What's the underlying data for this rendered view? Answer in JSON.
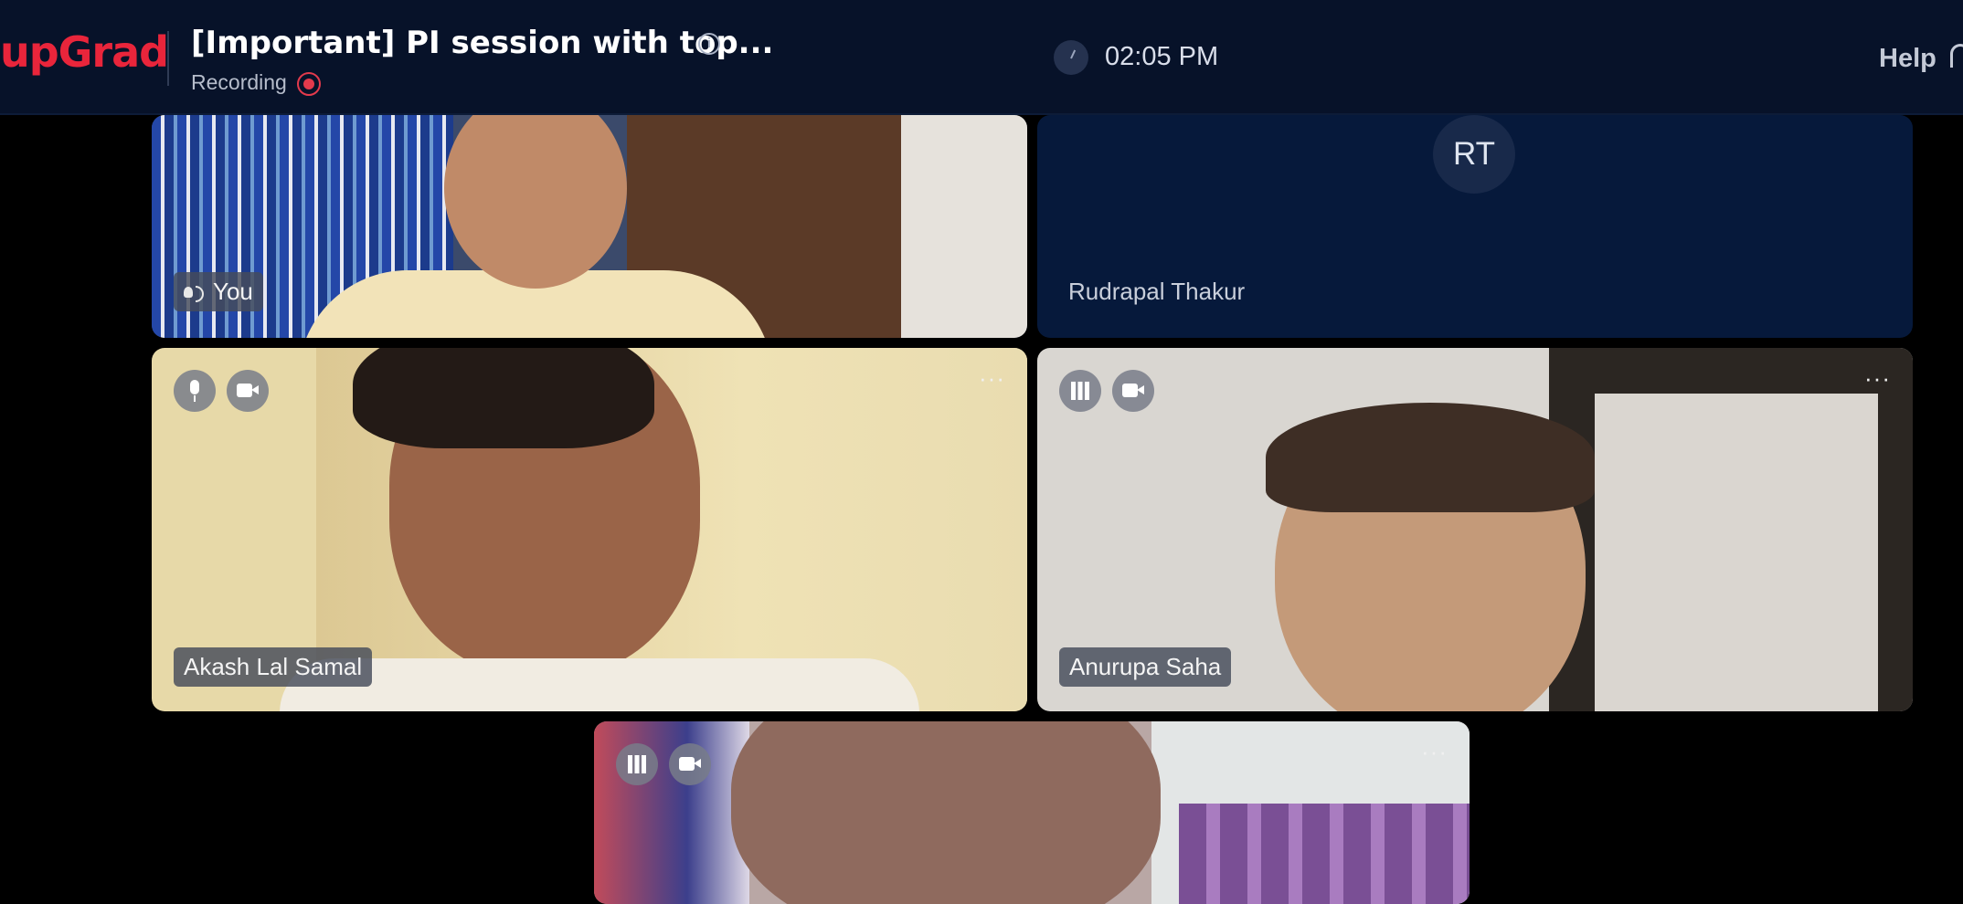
{
  "header": {
    "brand": "upGrad",
    "meeting_title": "[Important] PI session with top...",
    "recording_label": "Recording",
    "time": "02:05 PM",
    "help_label": "Help",
    "info_icon": "info-icon",
    "clock_icon": "clock-icon",
    "headset_icon": "headset-icon"
  },
  "participants": [
    {
      "name": "You",
      "video": true
    },
    {
      "name": "Rudrapal Thakur",
      "initials": "RT",
      "video": false
    },
    {
      "name": "Akash Lal Samal",
      "video": true
    },
    {
      "name": "Anurupa Saha",
      "video": true
    },
    {
      "name": "",
      "video": true
    }
  ],
  "controls": {
    "more_symbol": "···"
  },
  "colors": {
    "brand_red": "#e9253b",
    "topbar_bg": "#071229",
    "recording_red": "#e33a4c"
  }
}
